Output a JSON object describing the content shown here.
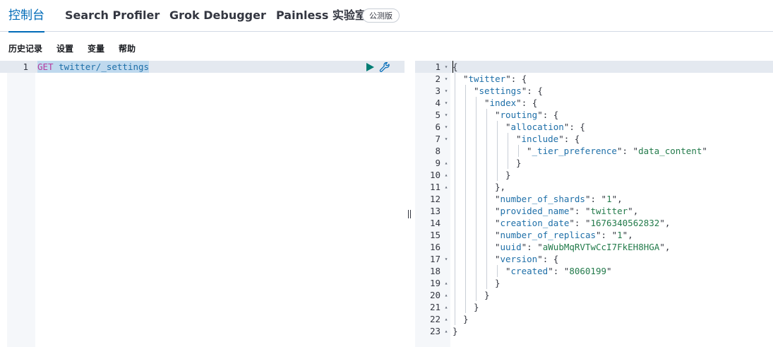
{
  "tabs": [
    "控制台",
    "Search Profiler",
    "Grok Debugger",
    "Painless 实验室"
  ],
  "badge": "公测版",
  "menu": [
    "历史记录",
    "设置",
    "变量",
    "帮助"
  ],
  "request": {
    "line_number": "1",
    "method": "GET",
    "path": "twitter/_settings"
  },
  "response": {
    "lines": [
      {
        "n": "1",
        "fold": "open",
        "depth": 0,
        "text": "{"
      },
      {
        "n": "2",
        "fold": "open",
        "depth": 1,
        "key": "twitter",
        "tail": ": {"
      },
      {
        "n": "3",
        "fold": "open",
        "depth": 2,
        "key": "settings",
        "tail": ": {"
      },
      {
        "n": "4",
        "fold": "open",
        "depth": 3,
        "key": "index",
        "tail": ": {"
      },
      {
        "n": "5",
        "fold": "open",
        "depth": 4,
        "key": "routing",
        "tail": ": {"
      },
      {
        "n": "6",
        "fold": "open",
        "depth": 5,
        "key": "allocation",
        "tail": ": {"
      },
      {
        "n": "7",
        "fold": "open",
        "depth": 6,
        "key": "include",
        "tail": ": {"
      },
      {
        "n": "8",
        "fold": "",
        "depth": 7,
        "key": "_tier_preference",
        "value": "data_content"
      },
      {
        "n": "9",
        "fold": "close",
        "depth": 6,
        "text": "}"
      },
      {
        "n": "10",
        "fold": "close",
        "depth": 5,
        "text": "}"
      },
      {
        "n": "11",
        "fold": "close",
        "depth": 4,
        "text": "},"
      },
      {
        "n": "12",
        "fold": "",
        "depth": 4,
        "key": "number_of_shards",
        "value": "1",
        "comma": ","
      },
      {
        "n": "13",
        "fold": "",
        "depth": 4,
        "key": "provided_name",
        "value": "twitter",
        "comma": ","
      },
      {
        "n": "14",
        "fold": "",
        "depth": 4,
        "key": "creation_date",
        "value": "1676340562832",
        "comma": ","
      },
      {
        "n": "15",
        "fold": "",
        "depth": 4,
        "key": "number_of_replicas",
        "value": "1",
        "comma": ","
      },
      {
        "n": "16",
        "fold": "",
        "depth": 4,
        "key": "uuid",
        "value": "aWubMqRVTwCcI7FkEH8HGA",
        "comma": ","
      },
      {
        "n": "17",
        "fold": "open",
        "depth": 4,
        "key": "version",
        "tail": ": {"
      },
      {
        "n": "18",
        "fold": "",
        "depth": 5,
        "key": "created",
        "value": "8060199"
      },
      {
        "n": "19",
        "fold": "close",
        "depth": 4,
        "text": "}"
      },
      {
        "n": "20",
        "fold": "close",
        "depth": 3,
        "text": "}"
      },
      {
        "n": "21",
        "fold": "close",
        "depth": 2,
        "text": "}"
      },
      {
        "n": "22",
        "fold": "close",
        "depth": 1,
        "text": "}"
      },
      {
        "n": "23",
        "fold": "close",
        "depth": 0,
        "text": "}"
      }
    ]
  },
  "icons": {
    "run": "play-icon",
    "options": "wrench-icon",
    "fold_open": "fold-open-icon",
    "fold_close": "fold-close-icon"
  },
  "colors": {
    "accent": "#006bb8",
    "method": "#b63c9f",
    "key": "#1e6fa8",
    "string": "#237b4b",
    "run_icon": "#017d73"
  }
}
